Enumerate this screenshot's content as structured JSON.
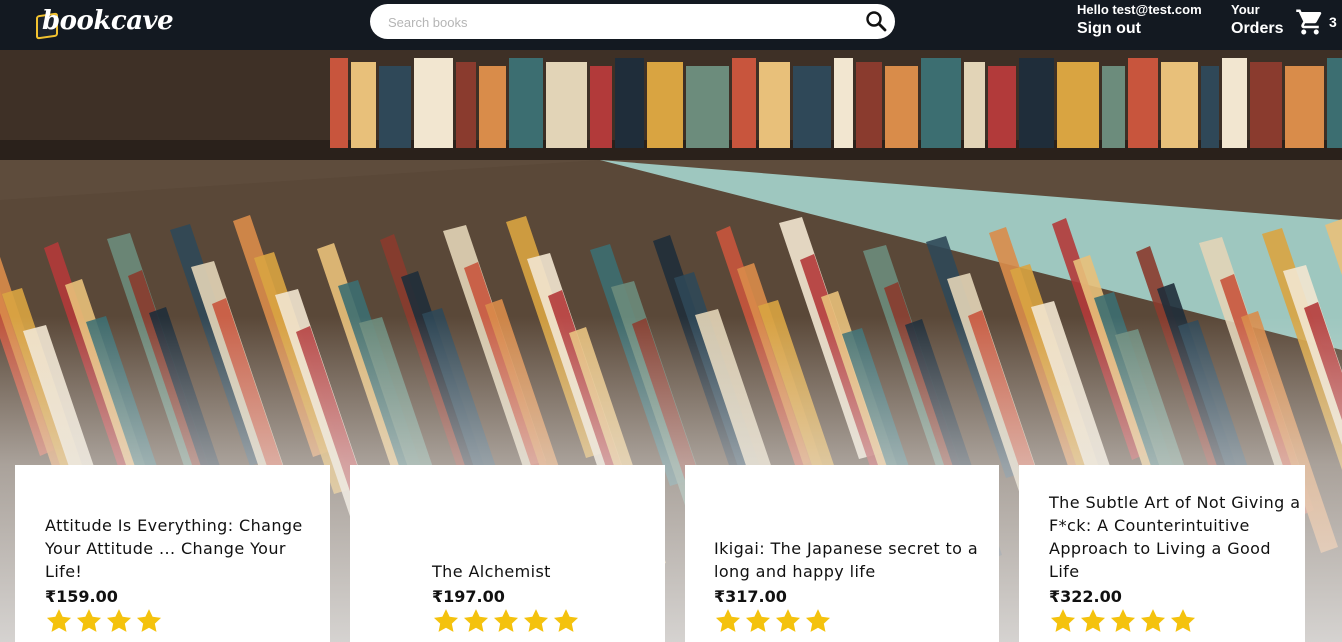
{
  "header": {
    "logo_text": "bookcave",
    "search_placeholder": "Search books",
    "greeting": "Hello test@test.com",
    "sign_out": "Sign out",
    "orders_top": "Your",
    "orders_bottom": "Orders",
    "cart_count": "3"
  },
  "colors": {
    "topbar": "#131921",
    "star": "#f4c20d",
    "logo_accent": "#f2c230"
  },
  "products": [
    {
      "title": "Attitude Is Everything: Change Your Attitude ... Change Your Life!",
      "price": "₹159.00",
      "rating": 4
    },
    {
      "title": "The Alchemist",
      "price": "₹197.00",
      "rating": 5
    },
    {
      "title": "Ikigai: The Japanese secret to a long and happy life",
      "price": "₹317.00",
      "rating": 4
    },
    {
      "title": "The Subtle Art of Not Giving a F*ck: A Counterintuitive Approach to Living a Good Life",
      "price": "₹322.00",
      "rating": 5
    }
  ]
}
